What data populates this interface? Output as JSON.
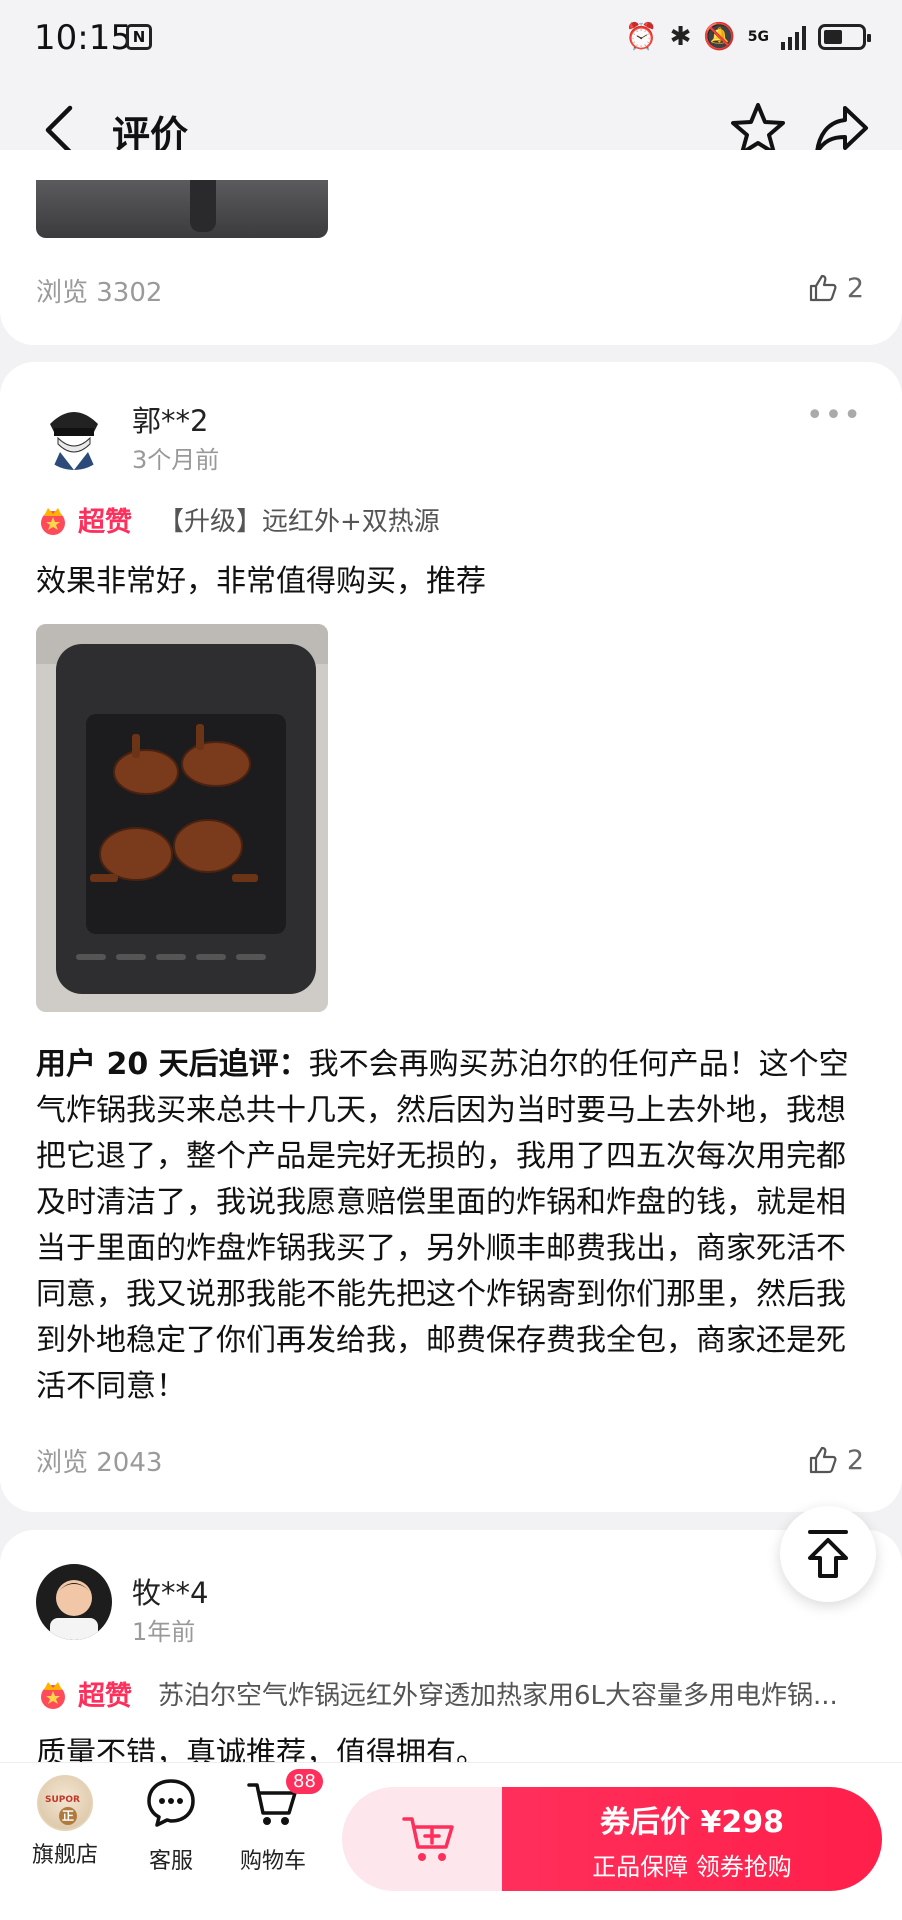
{
  "status": {
    "time": "10:15",
    "nfc": "N",
    "network": "5G"
  },
  "header": {
    "title": "评价"
  },
  "reviews": [
    {
      "views": "浏览 3302",
      "likes": "2"
    },
    {
      "user": "郭**2",
      "time": "3个月前",
      "badge": "超赞",
      "variant": "【升级】远红外+双热源",
      "text": "效果非常好，非常值得购买，推荐",
      "followup_label": "用户 20 天后追评：",
      "followup": "我不会再购买苏泊尔的任何产品！这个空气炸锅我买来总共十几天，然后因为当时要马上去外地，我想把它退了，整个产品是完好无损的，我用了四五次每次用完都及时清洁了，我说我愿意赔偿里面的炸锅和炸盘的钱，就是相当于里面的炸盘炸锅我买了，另外顺丰邮费我出，商家死活不同意，我又说那我能不能先把这个炸锅寄到你们那里，然后我到外地稳定了你们再发给我，邮费保存费我全包，商家还是死活不同意！",
      "views": "浏览 2043",
      "likes": "2"
    },
    {
      "user": "牧**4",
      "time": "1年前",
      "badge": "超赞",
      "variant": "苏泊尔空气炸锅远红外穿透加热家用6L大容量多用电炸锅...",
      "text": "质量不错，真诚推荐，值得拥有。"
    }
  ],
  "bottom": {
    "store": "旗舰店",
    "store_logo_text": "SUPOR",
    "store_logo_mark": "正",
    "service": "客服",
    "cart": "购物车",
    "cart_count": "88",
    "buy_price": "券后价 ¥298",
    "buy_sub": "正品保障  领券抢购"
  },
  "colors": {
    "accent": "#ff2f5b",
    "muted": "#9a9a9a"
  }
}
